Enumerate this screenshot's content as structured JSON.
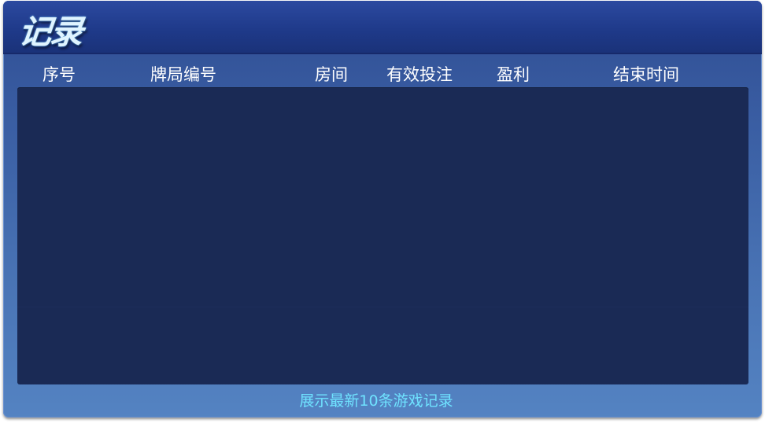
{
  "header": {
    "title": "记录"
  },
  "table": {
    "columns": [
      "序号",
      "牌局编号",
      "房间",
      "有效投注",
      "盈利",
      "结束时间"
    ],
    "rows": []
  },
  "footer": {
    "note": "展示最新10条游戏记录"
  },
  "colors": {
    "header_bg": "#1f3a8a",
    "panel_bg": "#4a75b6",
    "records_bg": "#1a2a55",
    "footer_text": "#6fe3ff"
  }
}
